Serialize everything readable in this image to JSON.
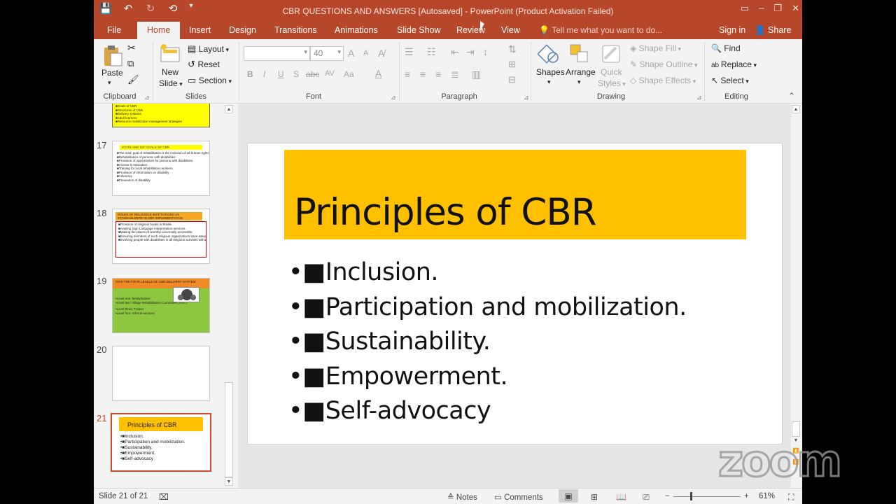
{
  "titlebar": {
    "title": "CBR QUESTIONS AND ANSWERS [Autosaved] - PowerPoint (Product Activation Failed)",
    "qat": [
      "💾",
      "↶",
      "↻",
      "⟲",
      "▾"
    ],
    "window_controls": [
      "▭",
      "–",
      "❐",
      "✕"
    ]
  },
  "tabs": [
    "File",
    "Home",
    "Insert",
    "Design",
    "Transitions",
    "Animations",
    "Slide Show",
    "Review",
    "View"
  ],
  "tellme": "Tell me what you want to do...",
  "signin": "Sign in",
  "share": "Share",
  "ribbon": {
    "clipboard": {
      "paste": "Paste",
      "label": "Clipboard"
    },
    "slides": {
      "new_slide": "New",
      "new_slide2": "Slide",
      "layout": "Layout",
      "reset": "Reset",
      "section": "Section",
      "label": "Slides"
    },
    "font": {
      "size": "40",
      "label": "Font",
      "bold": "B",
      "italic": "I",
      "underline": "U",
      "shadow": "S",
      "strike": "abc",
      "spacing": "AV",
      "case": "Aa",
      "grow": "A",
      "shrink": "A"
    },
    "paragraph": {
      "label": "Paragraph"
    },
    "drawing": {
      "shapes": "Shapes",
      "arrange": "Arrange",
      "quick": "Quick",
      "styles": "Styles",
      "fill": "Shape Fill",
      "outline": "Shape Outline",
      "effects": "Shape Effects",
      "label": "Drawing"
    },
    "editing": {
      "find": "Find",
      "replace": "Replace",
      "select": "Select",
      "label": "Editing"
    }
  },
  "thumbs": [
    {
      "num": "",
      "lines": [
        "■Goals of CBR.",
        "■Structures of CBR.",
        "■Delivery systems.",
        "■Adult learners",
        "■Resource mobilization management strategies"
      ]
    },
    {
      "num": "17",
      "heading": "STATE AND SIX GOALS OF CBR.",
      "lines": [
        "■The main goal of rehabilitation is the inclusion of all human rights...",
        "■Rehabilitation of persons with disabilities",
        "■Provision of opportunities for persons with disabilities.",
        "■Access to education.",
        "■Training for local rehabilitation workers",
        "■Provision of information on disability",
        "■Advocacy",
        "■Prevention of disability"
      ]
    },
    {
      "num": "18",
      "heading": "ROLES OF RELIGIOUS INSTITUTIONS AS STAKEHOLDERS IN CBR IMPLEMENTATION",
      "lines": [
        "■Provision of religious books in Braille.",
        "■Availing Sign Language interpretation services.",
        "■Making the places of worship universally accessible.",
        "■Ensuring members of such religious organizations have adequate information and understanding of disability.",
        "■Involving people with disabilities in all religious activities without any prejudices."
      ]
    },
    {
      "num": "19",
      "heading": "GIVE THE FOUR LEVELS OF CBR DELIVERY SYSTEM",
      "lines": [
        "•Level one: family/trainer",
        "•Level two: Village Rehabilitation Committee (VRC)",
        "•Level three: Trainer",
        "•Level four: referral services"
      ]
    },
    {
      "num": "20"
    },
    {
      "num": "21",
      "heading": "Principles of CBR",
      "lines": [
        "•■Inclusion.",
        "•■Participation and mobilization.",
        "•■Sustainability.",
        "•■Empowerment.",
        "•■Self-advocacy"
      ]
    }
  ],
  "slide": {
    "title": "Principles of CBR",
    "bullets": [
      "•■Inclusion.",
      "•■Participation and mobilization.",
      "•■Sustainability.",
      "•■Empowerment.",
      "•■Self-advocacy"
    ],
    "title_bg": "#ffc000"
  },
  "status": {
    "slide_info": "Slide 21 of 21",
    "notes": "Notes",
    "comments": "Comments",
    "zoom": "61%",
    "minus": "−",
    "plus": "+"
  },
  "watermark": "zoom",
  "colors": {
    "accent": "#b7472a"
  }
}
